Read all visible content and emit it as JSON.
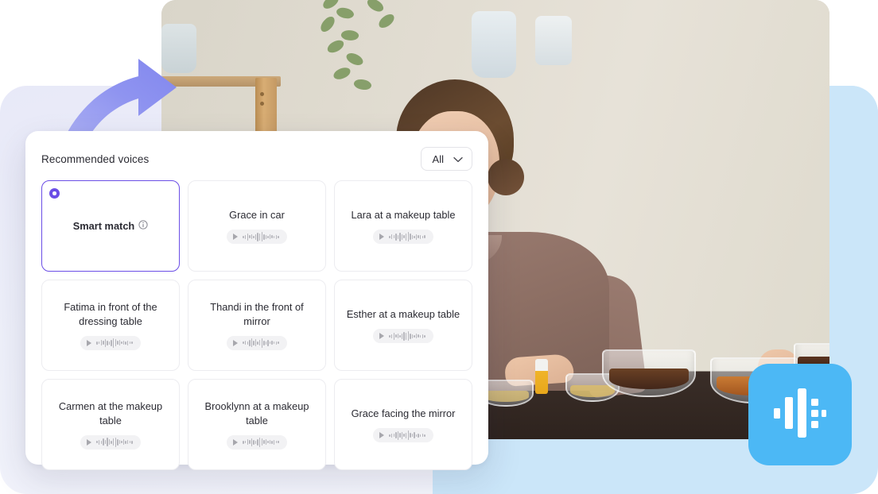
{
  "panel": {
    "title": "Recommended voices",
    "filter": {
      "label": "All",
      "chevron_icon": "chevron-down-icon"
    },
    "selected_card": {
      "label": "Smart match",
      "info_icon": "info-icon",
      "radio_icon": "radio-selected-icon"
    },
    "voices": [
      {
        "label": "Grace in car",
        "play_icon": "play-icon",
        "waveform_icon": "waveform-icon"
      },
      {
        "label": "Lara at a makeup table",
        "play_icon": "play-icon",
        "waveform_icon": "waveform-icon"
      },
      {
        "label": "Fatima in front of the dressing table",
        "play_icon": "play-icon",
        "waveform_icon": "waveform-icon"
      },
      {
        "label": "Thandi in the front of mirror",
        "play_icon": "play-icon",
        "waveform_icon": "waveform-icon"
      },
      {
        "label": "Esther at a makeup table",
        "play_icon": "play-icon",
        "waveform_icon": "waveform-icon"
      },
      {
        "label": "Carmen at the makeup table",
        "play_icon": "play-icon",
        "waveform_icon": "waveform-icon"
      },
      {
        "label": "Brooklynn at a makeup table",
        "play_icon": "play-icon",
        "waveform_icon": "waveform-icon"
      },
      {
        "label": "Grace facing the mirror",
        "play_icon": "play-icon",
        "waveform_icon": "waveform-icon"
      }
    ]
  },
  "media": {
    "preview_name": "video-preview",
    "scene_description": "Woman standing at a kitchen counter with glass bowls"
  },
  "decorations": {
    "arrow_icon": "curved-arrow-icon",
    "app_badge_icon": "audio-waveform-icon"
  },
  "colors": {
    "accent_purple": "#6b4ee6",
    "arrow_blue": "#8e93f0",
    "badge_blue": "#4cb8f5",
    "bg_left": "#eceefa",
    "bg_right": "#cbe6f9",
    "card_border": "#ececf0",
    "text_primary": "#2b2b33"
  }
}
